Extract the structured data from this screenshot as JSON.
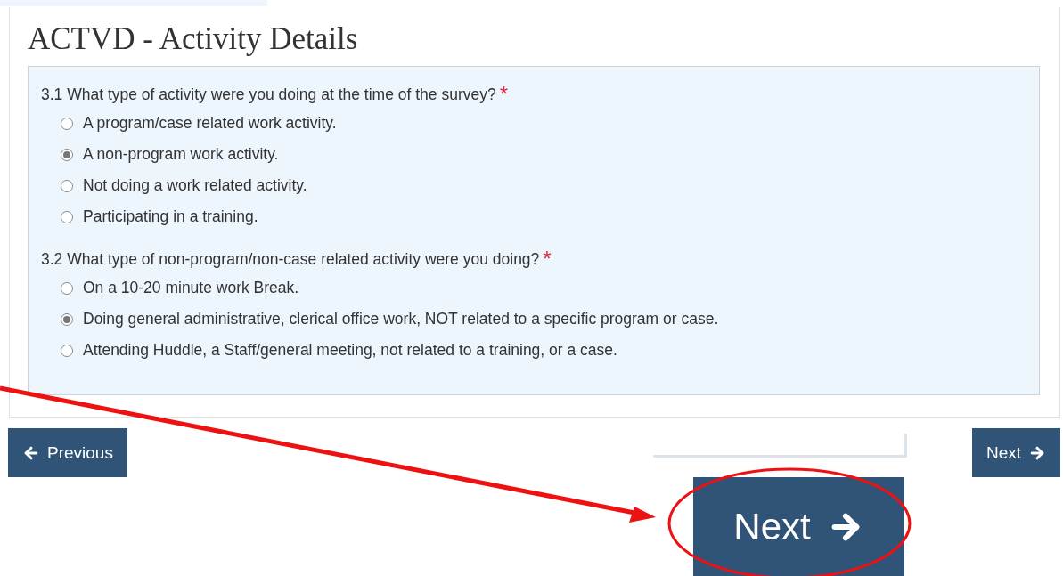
{
  "title": "ACTVD - Activity Details",
  "questions": [
    {
      "label": "3.1 What type of activity were you doing at the time of the survey?",
      "required_mark": "*",
      "options": [
        {
          "label": "A program/case related work activity.",
          "selected": false
        },
        {
          "label": "A non-program work activity.",
          "selected": true
        },
        {
          "label": "Not doing a work related activity.",
          "selected": false
        },
        {
          "label": "Participating in a training.",
          "selected": false
        }
      ]
    },
    {
      "label": "3.2 What type of non-program/non-case related activity were you doing?",
      "required_mark": "*",
      "options": [
        {
          "label": "On a 10-20 minute work Break.",
          "selected": false
        },
        {
          "label": "Doing general administrative, clerical office work, NOT related to a specific program or case.",
          "selected": true
        },
        {
          "label": "Attending Huddle, a Staff/general meeting, not related to a training, or a case.",
          "selected": false
        }
      ]
    }
  ],
  "buttons": {
    "previous": "Previous",
    "next": "Next"
  },
  "zoomed_button": {
    "label": "Next"
  }
}
